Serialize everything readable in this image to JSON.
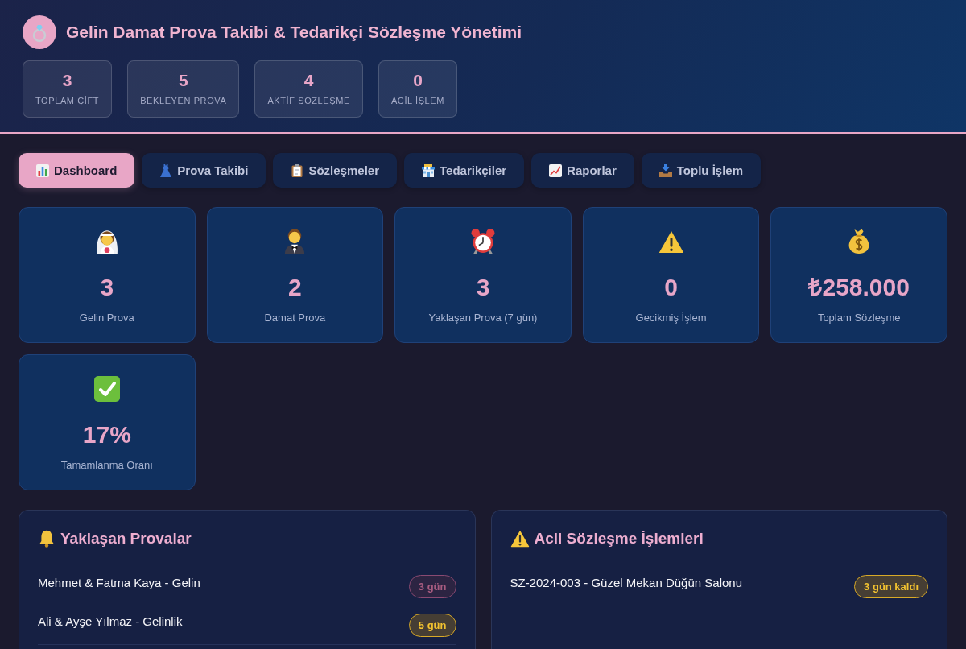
{
  "header": {
    "title": "Gelin Damat Prova Takibi & Tedarikçi Sözleşme Yönetimi",
    "stats": [
      {
        "value": "3",
        "label": "TOPLAM ÇİFT"
      },
      {
        "value": "5",
        "label": "BEKLEYEN PROVA"
      },
      {
        "value": "4",
        "label": "AKTİF SÖZLEŞME"
      },
      {
        "value": "0",
        "label": "ACİL İŞLEM"
      }
    ]
  },
  "tabs": [
    {
      "label": "Dashboard",
      "selected": true
    },
    {
      "label": "Prova Takibi",
      "selected": false
    },
    {
      "label": "Sözleşmeler",
      "selected": false
    },
    {
      "label": "Tedarikçiler",
      "selected": false
    },
    {
      "label": "Raporlar",
      "selected": false
    },
    {
      "label": "Toplu İşlem",
      "selected": false
    }
  ],
  "stat_cards": [
    {
      "value": "3",
      "label": "Gelin Prova"
    },
    {
      "value": "2",
      "label": "Damat Prova"
    },
    {
      "value": "3",
      "label": "Yaklaşan Prova (7 gün)"
    },
    {
      "value": "0",
      "label": "Gecikmiş İşlem"
    },
    {
      "value": "₺258.000",
      "label": "Toplam Sözleşme"
    },
    {
      "value": "17%",
      "label": "Tamamlanma Oranı"
    }
  ],
  "panels": [
    {
      "title": "Yaklaşan Provalar",
      "items": [
        {
          "text": "Mehmet & Fatma Kaya - Gelin",
          "badge": "3 gün",
          "kind": "urgent"
        },
        {
          "text": "Ali & Ayşe Yılmaz - Gelinlik",
          "badge": "5 gün",
          "kind": "warning"
        }
      ]
    },
    {
      "title": "Acil Sözleşme İşlemleri",
      "items": [
        {
          "text": "SZ-2024-003 - Güzel Mekan Düğün Salonu",
          "badge": "3 gün kaldı",
          "kind": "warning"
        }
      ]
    }
  ]
}
